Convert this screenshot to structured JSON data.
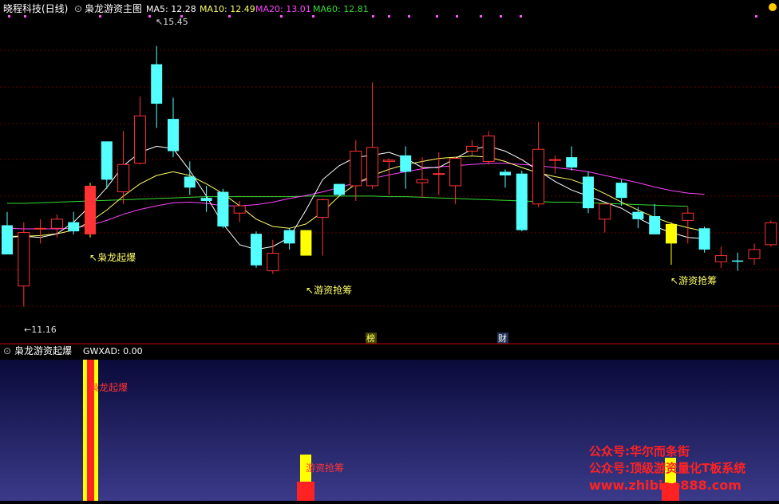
{
  "header": {
    "stock": "晓程科技(日线)",
    "indicator": "枭龙游资主图",
    "ma": [
      {
        "label": "MA5: 12.28",
        "color": "#ffffff"
      },
      {
        "label": "MA10: 12.49",
        "color": "#ffff66"
      },
      {
        "label": "MA20: 13.01",
        "color": "#ff44ff"
      },
      {
        "label": "MA60: 12.81",
        "color": "#33dd33"
      }
    ]
  },
  "price_panel": {
    "high_label": "15.45",
    "low_label": "11.16",
    "signals": [
      "枭龙起爆",
      "游资抢筹",
      "游资抢筹"
    ],
    "markers": [
      "榜",
      "财"
    ]
  },
  "sub_panel": {
    "title": "枭龙游资起爆",
    "value_label": "GWXAD: 0.00",
    "signal_labels": [
      "枭龙起爆",
      "游资抢筹"
    ]
  },
  "watermark": {
    "line1": "公众号:华尔而条街",
    "line2": "公众号:顶级游资量化T板系统",
    "line3": "www.zhibiao888.com"
  },
  "colors": {
    "up": "#ff3333",
    "down": "#54ffff",
    "signal": "#ffff00",
    "sub_bg_top": "#0a0a3a",
    "sub_bg_bottom": "#3a3a8a"
  },
  "chart_data": {
    "type": "candlestick",
    "ylim": [
      10.8,
      15.8
    ],
    "candles": [
      {
        "o": 12.5,
        "h": 12.72,
        "l": 12.05,
        "c": 12.02
      },
      {
        "o": 11.5,
        "h": 12.55,
        "l": 11.16,
        "c": 12.38
      },
      {
        "o": 12.45,
        "h": 12.6,
        "l": 12.2,
        "c": 12.45
      },
      {
        "o": 12.45,
        "h": 12.68,
        "l": 12.3,
        "c": 12.6
      },
      {
        "o": 12.55,
        "h": 12.72,
        "l": 12.35,
        "c": 12.4
      },
      {
        "o": 12.35,
        "h": 13.2,
        "l": 12.3,
        "c": 13.15,
        "signal": true
      },
      {
        "o": 13.88,
        "h": 13.88,
        "l": 13.1,
        "c": 13.25
      },
      {
        "o": 13.05,
        "h": 14.05,
        "l": 12.85,
        "c": 13.5
      },
      {
        "o": 13.52,
        "h": 14.62,
        "l": 13.5,
        "c": 14.3
      },
      {
        "o": 15.15,
        "h": 15.45,
        "l": 14.1,
        "c": 14.5
      },
      {
        "o": 14.25,
        "h": 14.6,
        "l": 13.62,
        "c": 13.72
      },
      {
        "o": 13.3,
        "h": 13.55,
        "l": 13.0,
        "c": 13.12
      },
      {
        "o": 12.95,
        "h": 13.15,
        "l": 12.72,
        "c": 12.9
      },
      {
        "o": 13.05,
        "h": 13.1,
        "l": 12.45,
        "c": 12.48
      },
      {
        "o": 12.7,
        "h": 12.9,
        "l": 12.55,
        "c": 12.82
      },
      {
        "o": 12.36,
        "h": 12.4,
        "l": 11.8,
        "c": 11.84
      },
      {
        "o": 11.75,
        "h": 12.26,
        "l": 11.7,
        "c": 12.04
      },
      {
        "o": 12.42,
        "h": 12.45,
        "l": 12.1,
        "c": 12.2
      },
      {
        "o": 12.0,
        "h": 12.42,
        "l": 12.0,
        "c": 12.42,
        "signal": true
      },
      {
        "o": 12.63,
        "h": 12.94,
        "l": 12.0,
        "c": 12.92
      },
      {
        "o": 13.18,
        "h": 13.18,
        "l": 12.98,
        "c": 13.0
      },
      {
        "o": 13.15,
        "h": 13.9,
        "l": 12.9,
        "c": 13.72
      },
      {
        "o": 13.15,
        "h": 14.85,
        "l": 13.1,
        "c": 13.78
      },
      {
        "o": 13.55,
        "h": 13.6,
        "l": 13.0,
        "c": 13.57
      },
      {
        "o": 13.65,
        "h": 13.8,
        "l": 13.1,
        "c": 13.38
      },
      {
        "o": 13.2,
        "h": 13.62,
        "l": 12.95,
        "c": 13.25
      },
      {
        "o": 13.35,
        "h": 13.7,
        "l": 13.0,
        "c": 13.35
      },
      {
        "o": 13.15,
        "h": 13.62,
        "l": 12.85,
        "c": 13.6
      },
      {
        "o": 13.72,
        "h": 13.9,
        "l": 13.65,
        "c": 13.8
      },
      {
        "o": 13.55,
        "h": 14.05,
        "l": 13.5,
        "c": 13.97
      },
      {
        "o": 13.38,
        "h": 13.42,
        "l": 13.12,
        "c": 13.32
      },
      {
        "o": 13.35,
        "h": 13.4,
        "l": 12.4,
        "c": 12.42
      },
      {
        "o": 12.85,
        "h": 14.2,
        "l": 12.8,
        "c": 13.75
      },
      {
        "o": 13.58,
        "h": 13.65,
        "l": 13.35,
        "c": 13.58
      },
      {
        "o": 13.62,
        "h": 13.8,
        "l": 13.4,
        "c": 13.45
      },
      {
        "o": 13.3,
        "h": 13.38,
        "l": 12.7,
        "c": 12.78
      },
      {
        "o": 12.6,
        "h": 12.85,
        "l": 12.38,
        "c": 12.85
      },
      {
        "o": 13.2,
        "h": 13.25,
        "l": 12.82,
        "c": 12.95
      },
      {
        "o": 12.72,
        "h": 12.8,
        "l": 12.45,
        "c": 12.6
      },
      {
        "o": 12.65,
        "h": 12.85,
        "l": 12.4,
        "c": 12.35
      },
      {
        "o": 12.2,
        "h": 12.55,
        "l": 11.85,
        "c": 12.52,
        "signal": true
      },
      {
        "o": 12.58,
        "h": 12.8,
        "l": 12.2,
        "c": 12.7
      },
      {
        "o": 12.45,
        "h": 12.48,
        "l": 12.05,
        "c": 12.1
      },
      {
        "o": 11.9,
        "h": 12.15,
        "l": 11.8,
        "c": 12.0
      },
      {
        "o": 11.92,
        "h": 12.05,
        "l": 11.75,
        "c": 11.9
      },
      {
        "o": 11.95,
        "h": 12.2,
        "l": 11.85,
        "c": 12.1
      },
      {
        "o": 12.18,
        "h": 12.58,
        "l": 12.15,
        "c": 12.54
      }
    ],
    "ma5": [
      12.3,
      12.32,
      12.3,
      12.36,
      12.55,
      12.82,
      13.12,
      13.48,
      13.7,
      13.8,
      13.76,
      13.4,
      12.98,
      12.52,
      12.18,
      12.1,
      12.15,
      12.3,
      12.75,
      13.25,
      13.48,
      13.62,
      13.65,
      13.7,
      13.6,
      13.45,
      13.45,
      13.6,
      13.75,
      13.8,
      13.72,
      13.58,
      13.4,
      13.22,
      13.08,
      12.98,
      12.88,
      12.78,
      12.62,
      12.48,
      12.38,
      12.3,
      12.28
    ],
    "ma10": [
      12.32,
      12.32,
      12.33,
      12.36,
      12.42,
      12.56,
      12.75,
      12.98,
      13.18,
      13.32,
      13.38,
      13.32,
      13.18,
      13.02,
      12.82,
      12.6,
      12.48,
      12.45,
      12.52,
      12.72,
      12.98,
      13.18,
      13.32,
      13.42,
      13.5,
      13.55,
      13.6,
      13.62,
      13.64,
      13.62,
      13.55,
      13.45,
      13.36,
      13.3,
      13.25,
      13.15,
      13.02,
      12.88,
      12.75,
      12.63,
      12.53,
      12.46,
      12.4
    ],
    "ma20": [
      12.45,
      12.44,
      12.44,
      12.44,
      12.45,
      12.5,
      12.58,
      12.68,
      12.76,
      12.82,
      12.87,
      12.88,
      12.86,
      12.82,
      12.82,
      12.84,
      12.88,
      12.94,
      12.99,
      13.05,
      13.12,
      13.2,
      13.27,
      13.33,
      13.38,
      13.43,
      13.46,
      13.48,
      13.5,
      13.52,
      13.52,
      13.5,
      13.48,
      13.45,
      13.42,
      13.38,
      13.32,
      13.26,
      13.2,
      13.13,
      13.07,
      13.03,
      13.01
    ],
    "ma60": [
      12.86,
      12.86,
      12.87,
      12.88,
      12.89,
      12.9,
      12.91,
      12.92,
      12.93,
      12.94,
      12.95,
      12.96,
      12.97,
      12.97,
      12.97,
      12.97,
      12.97,
      12.97,
      12.98,
      12.98,
      12.98,
      12.98,
      12.98,
      12.97,
      12.97,
      12.96,
      12.95,
      12.94,
      12.93,
      12.92,
      12.91,
      12.9,
      12.89,
      12.88,
      12.88,
      12.87,
      12.86,
      12.85,
      12.84,
      12.83,
      12.82,
      12.81
    ]
  }
}
